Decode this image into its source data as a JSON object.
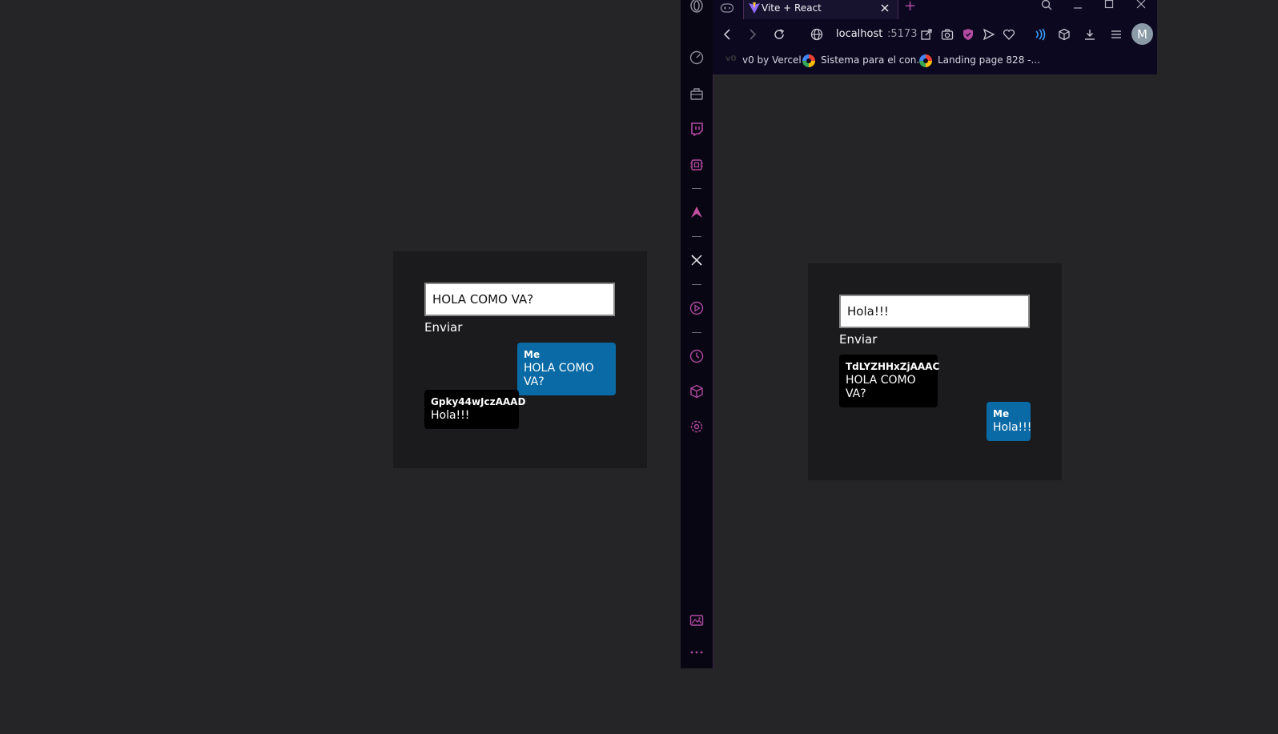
{
  "left_app": {
    "input_value": "HOLA COMO VA?",
    "send_label": "Enviar",
    "messages": [
      {
        "author": "Me",
        "text": "HOLA COMO VA?"
      },
      {
        "author": "Gpky44wJczAAAD",
        "text": "Hola!!!"
      }
    ]
  },
  "right_app": {
    "input_value": "Hola!!!",
    "send_label": "Enviar",
    "messages": [
      {
        "author": "TdLYZHHxZjAAAC",
        "text": "HOLA COMO VA?"
      },
      {
        "author": "Me",
        "text": "Hola!!!"
      }
    ]
  },
  "browser": {
    "tab": {
      "title": "Vite + React",
      "icon": "vite-logo-icon"
    },
    "new_tab_label": "+",
    "address": {
      "host": "localhost",
      "port": ":5173"
    },
    "profile_initial": "M",
    "bookmarks": [
      {
        "label": "v0 by Vercel",
        "icon": "v0-icon"
      },
      {
        "label": "Sistema para el con...",
        "icon": "colorful-circle-icon"
      },
      {
        "label": "Landing page 828 -...",
        "icon": "colorful-circle-icon"
      }
    ],
    "sidebar_icons": [
      "speed-dial-icon",
      "bag-icon",
      "twitch-icon",
      "chip-icon",
      "aria-icon",
      "x-icon",
      "player-icon",
      "history-icon",
      "box-icon",
      "settings-icon",
      "gallery-icon",
      "more-icon"
    ]
  },
  "colors": {
    "page_bg": "#252528",
    "panel_bg": "#1b1b1d",
    "me_bubble": "#0a6aa5",
    "other_bubble": "#000000",
    "browser_accent": "#b14aa0"
  }
}
